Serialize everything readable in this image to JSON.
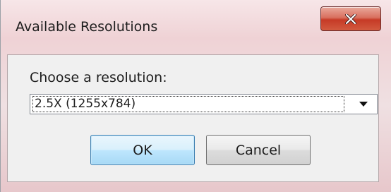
{
  "window": {
    "title": "Available Resolutions",
    "close_icon": "close-x-icon"
  },
  "dialog": {
    "prompt": "Choose a resolution:",
    "resolution_select": {
      "selected": "2.5X (1255x784)",
      "arrow_icon": "dropdown-arrow-icon"
    },
    "ok_label": "OK",
    "cancel_label": "Cancel"
  },
  "colors": {
    "close_button": "#c63a26",
    "ok_button_border": "#3c7fb1",
    "client_background": "#f0f0f0"
  }
}
